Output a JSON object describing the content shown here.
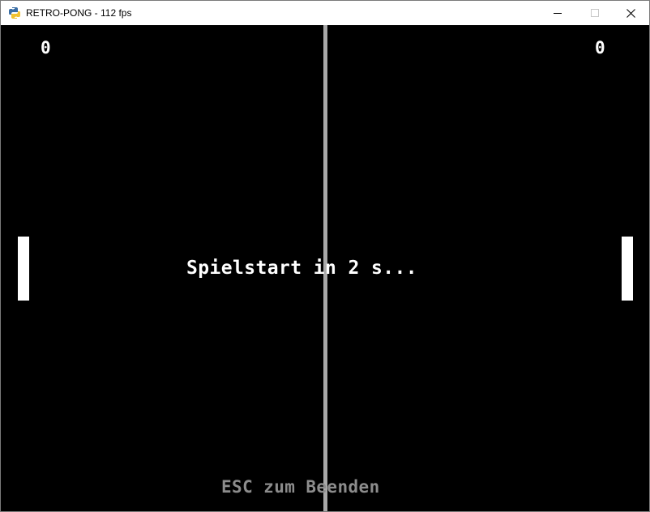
{
  "window": {
    "title": "RETRO-PONG - 112 fps",
    "app_icon": "python-snake-icon",
    "controls": {
      "minimize": "minimize-icon",
      "maximize": "maximize-icon",
      "close": "close-icon"
    }
  },
  "game": {
    "score_left": "0",
    "score_right": "0",
    "countdown_text": "Spielstart in 2 s...",
    "hint_text": "ESC zum Beenden",
    "colors": {
      "background": "#000000",
      "foreground": "#ffffff",
      "net": "#a8a8a8",
      "hint": "#8c8c8c"
    }
  }
}
